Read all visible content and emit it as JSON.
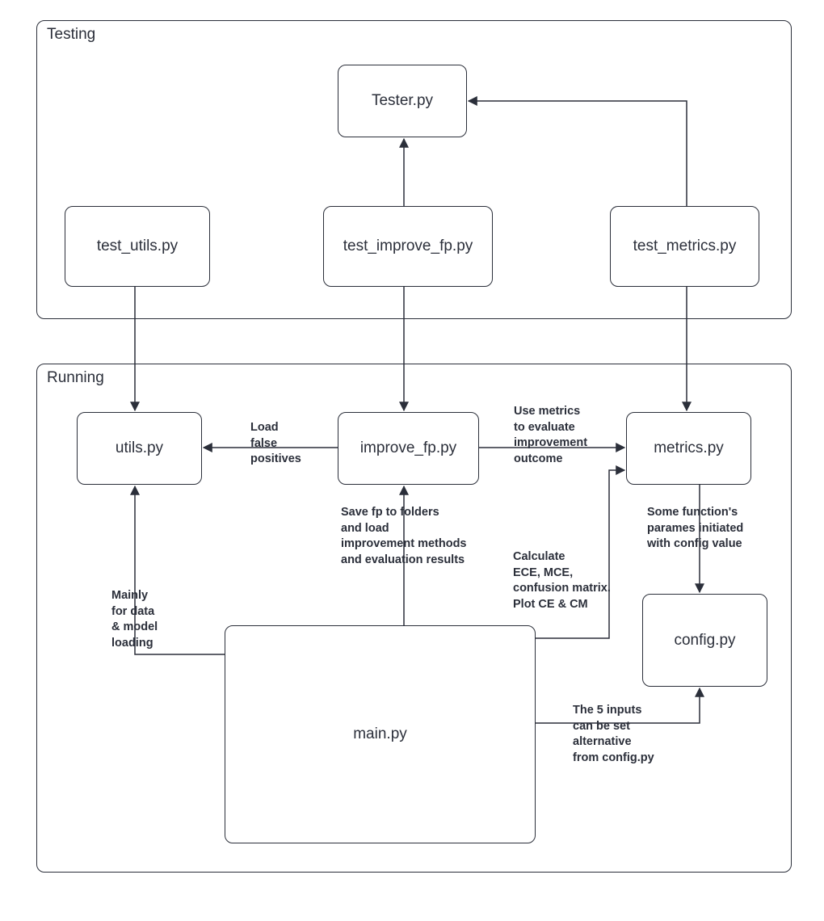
{
  "groups": {
    "testing": {
      "label": "Testing"
    },
    "running": {
      "label": "Running"
    }
  },
  "nodes": {
    "tester": {
      "label": "Tester.py"
    },
    "test_utils": {
      "label": "test_utils.py"
    },
    "test_improve_fp": {
      "label": "test_improve_fp.py"
    },
    "test_metrics": {
      "label": "test_metrics.py"
    },
    "utils": {
      "label": "utils.py"
    },
    "improve_fp": {
      "label": "improve_fp.py"
    },
    "metrics": {
      "label": "metrics.py"
    },
    "main": {
      "label": "main.py"
    },
    "config": {
      "label": "config.py"
    }
  },
  "edge_labels": {
    "load_fp": "Load\nfalse\npositives",
    "use_metrics": "Use metrics\nto evaluate\nimprovement\noutcome",
    "save_fp": "Save fp to folders\nand load\nimprovement methods\nand evaluation results",
    "calc": "Calculate\nECE, MCE,\nconfusion matrix.\nPlot CE & CM",
    "mainly": "Mainly\nfor data\n& model\nloading",
    "some_func": "Some function's\nparames initiated\nwith config value",
    "five_inputs": "The 5 inputs\ncan be set\nalternative\nfrom config.py"
  }
}
